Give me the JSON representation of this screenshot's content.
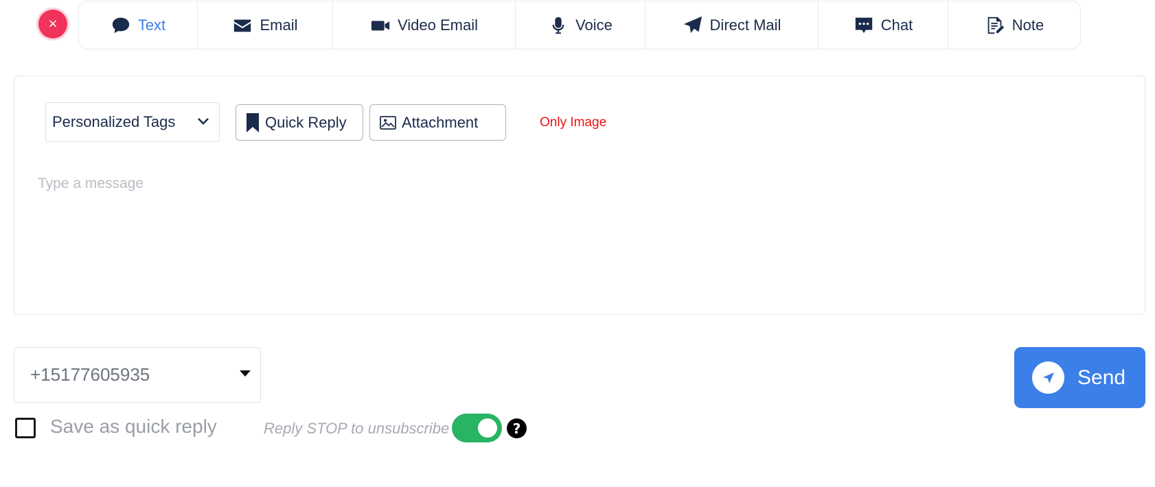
{
  "close_button": {
    "icon": "close-icon",
    "glyph": "×",
    "color": "#f0335a"
  },
  "tabs": [
    {
      "label": "Text",
      "icon": "chat-bubble-icon",
      "active": true
    },
    {
      "label": "Email",
      "icon": "envelope-icon",
      "active": false
    },
    {
      "label": "Video Email",
      "icon": "video-camera-icon",
      "active": false
    },
    {
      "label": "Voice",
      "icon": "microphone-icon",
      "active": false
    },
    {
      "label": "Direct Mail",
      "icon": "paper-plane-icon",
      "active": false
    },
    {
      "label": "Chat",
      "icon": "chat-dots-icon",
      "active": false
    },
    {
      "label": "Note",
      "icon": "note-edit-icon",
      "active": false
    }
  ],
  "composer": {
    "tags_select": "Personalized Tags",
    "quick_reply": "Quick Reply",
    "attachment": "Attachment",
    "only_image": "Only Image",
    "message_placeholder": "Type a message"
  },
  "phone": {
    "value": "+15177605935"
  },
  "send": {
    "label": "Send",
    "color": "#3b7fe8"
  },
  "footer": {
    "save_quick_reply": "Save as quick reply",
    "save_checked": false,
    "unsubscribe_text": "Reply STOP to unsubscribe",
    "unsubscribe_enabled": true,
    "help": "?"
  },
  "colors": {
    "accent": "#3b7fe8",
    "danger": "#f0335a",
    "success": "#28b463",
    "warning_text": "#ee1111"
  }
}
